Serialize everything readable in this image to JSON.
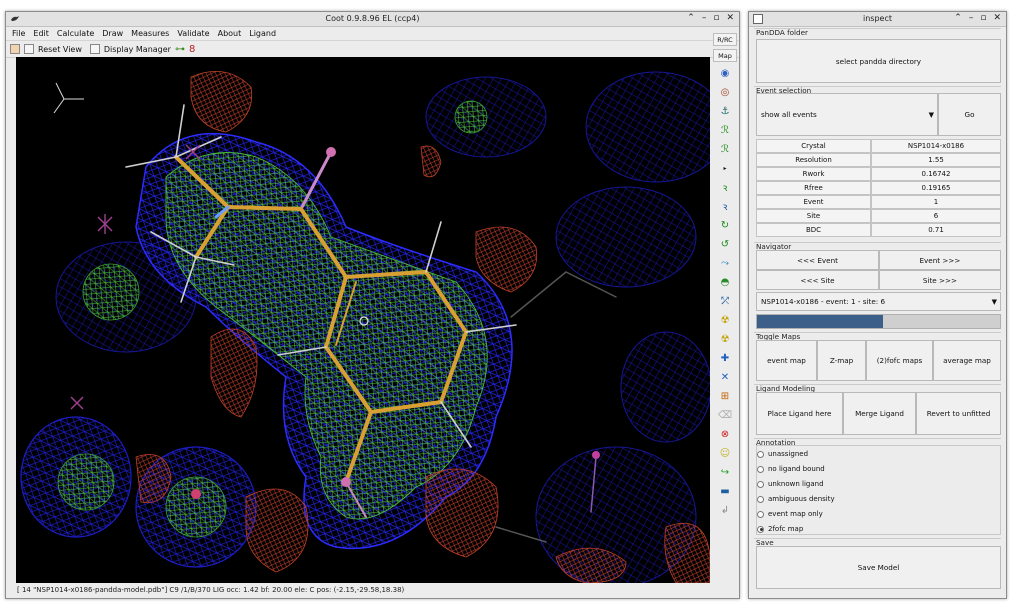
{
  "coot": {
    "title": "Coot 0.9.8.96 EL (ccp4)",
    "menu": [
      "File",
      "Edit",
      "Calculate",
      "Draw",
      "Measures",
      "Validate",
      "About",
      "Ligand"
    ],
    "toolbar": {
      "reset_view": "Reset View",
      "display_manager": "Display Manager"
    },
    "side_buttons": {
      "rrc": "R/RC",
      "map": "Map"
    },
    "status": "[ 14 \"NSP1014-x0186-pandda-model.pdb\"]  C9 /1/B/370 LIG occ: 1.42 bf: 20.00 ele:  C pos: (-2.15,-29.58,18.38)"
  },
  "inspect": {
    "title": "inspect",
    "pandda_folder": {
      "label": "PanDDA folder",
      "button": "select pandda directory"
    },
    "event_selection": {
      "label": "Event selection",
      "dropdown_value": "show all events",
      "go": "Go"
    },
    "table": [
      [
        "Crystal",
        "NSP1014-x0186"
      ],
      [
        "Resolution",
        "1.55"
      ],
      [
        "Rwork",
        "0.16742"
      ],
      [
        "Rfree",
        "0.19165"
      ],
      [
        "Event",
        "1"
      ],
      [
        "Site",
        "6"
      ],
      [
        "BDC",
        "0.71"
      ]
    ],
    "navigator": {
      "label": "Navigator",
      "prev_event": "<<< Event",
      "next_event": "Event >>>",
      "prev_site": "<<< Site",
      "next_site": "Site >>>",
      "dropdown_value": "NSP1014-x0186 - event: 1 - site: 6",
      "progress": 0.52
    },
    "toggle_maps": {
      "label": "Toggle Maps",
      "buttons": [
        "event map",
        "Z-map",
        "(2)fofc maps",
        "average map"
      ]
    },
    "ligand_modeling": {
      "label": "Ligand Modeling",
      "buttons": [
        "Place Ligand here",
        "Merge Ligand",
        "Revert to unfitted"
      ]
    },
    "annotation": {
      "label": "Annotation",
      "options": [
        "unassigned",
        "no ligand bound",
        "unknown ligand",
        "ambiguous density",
        "event map only",
        "2fofc map"
      ],
      "selected": 5
    },
    "save": {
      "label": "Save",
      "button": "Save Model"
    }
  }
}
